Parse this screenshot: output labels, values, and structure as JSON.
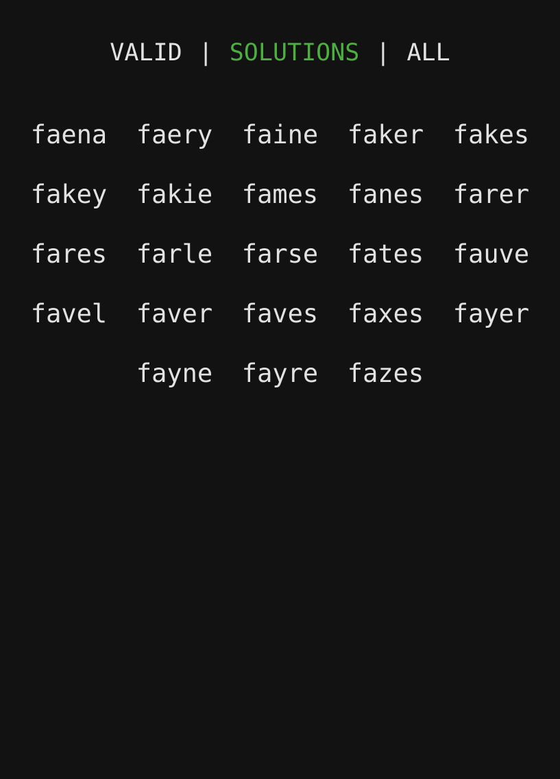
{
  "tabs": [
    {
      "label": "VALID",
      "active": false
    },
    {
      "label": "SOLUTIONS",
      "active": true
    },
    {
      "label": "ALL",
      "active": false
    }
  ],
  "separator": "|",
  "colors": {
    "background": "#121212",
    "text": "#e2e2e2",
    "active_tab": "#4caf3f"
  },
  "words": [
    "faena",
    "faery",
    "faine",
    "faker",
    "fakes",
    "fakey",
    "fakie",
    "fames",
    "fanes",
    "farer",
    "fares",
    "farle",
    "farse",
    "fates",
    "fauve",
    "favel",
    "faver",
    "faves",
    "faxes",
    "fayer",
    "fayne",
    "fayre",
    "fazes"
  ]
}
